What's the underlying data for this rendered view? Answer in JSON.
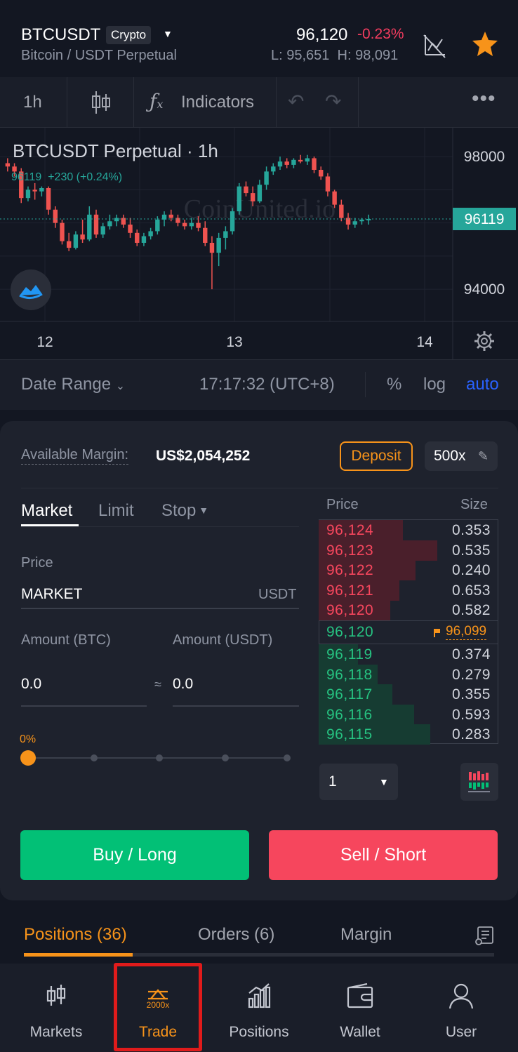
{
  "header": {
    "symbol": "BTCUSDT",
    "badge": "Crypto",
    "subtitle": "Bitcoin / USDT Perpetual",
    "price": "96,120",
    "change": "-0.23%",
    "hilo": "L: 95,651  H: 98,091",
    "icons": [
      "chart-off-icon",
      "star-icon"
    ]
  },
  "toolbar": {
    "interval": "1h",
    "indicators": "Indicators",
    "icons": [
      "candles-icon",
      "fx-icon",
      "undo-icon",
      "redo-icon",
      "more-icon"
    ]
  },
  "chart": {
    "title": "BTCUSDT Perpetual · 1h",
    "values": "96119  +230 (+0.24%)",
    "watermark": "CoinUnited.io",
    "y_labels": [
      "98000",
      "96119",
      "94000"
    ],
    "x_labels": [
      "12",
      "13",
      "14"
    ]
  },
  "chart_data": {
    "type": "candlestick",
    "ylim": [
      93200,
      98700
    ],
    "last_price": 96119,
    "ohlc": [
      [
        97800,
        97950,
        97550,
        97700
      ],
      [
        97700,
        97800,
        97400,
        97550
      ],
      [
        97550,
        97650,
        96600,
        96750
      ],
      [
        96750,
        97100,
        96650,
        97000
      ],
      [
        97000,
        97200,
        96700,
        96950
      ],
      [
        96950,
        97100,
        96800,
        97050
      ],
      [
        97050,
        97100,
        96250,
        96400
      ],
      [
        96400,
        96500,
        95850,
        96000
      ],
      [
        96000,
        96100,
        95350,
        95450
      ],
      [
        95450,
        95700,
        95150,
        95250
      ],
      [
        95250,
        95750,
        95200,
        95650
      ],
      [
        95650,
        96100,
        95400,
        95500
      ],
      [
        95500,
        96500,
        95450,
        96250
      ],
      [
        96250,
        96400,
        95550,
        95650
      ],
      [
        95650,
        96000,
        95550,
        95900
      ],
      [
        95900,
        96250,
        95800,
        96050
      ],
      [
        96050,
        96250,
        95900,
        96150
      ],
      [
        96150,
        96250,
        95850,
        95950
      ],
      [
        95950,
        96150,
        95550,
        95700
      ],
      [
        95700,
        95800,
        95300,
        95400
      ],
      [
        95400,
        95700,
        95300,
        95600
      ],
      [
        95600,
        95850,
        95500,
        95750
      ],
      [
        95750,
        96200,
        95650,
        96100
      ],
      [
        96100,
        96350,
        95900,
        96250
      ],
      [
        96250,
        96400,
        96050,
        96150
      ],
      [
        96150,
        96250,
        95900,
        96000
      ],
      [
        96000,
        96100,
        95800,
        95900
      ],
      [
        95900,
        96150,
        95800,
        96000
      ],
      [
        96000,
        96200,
        95750,
        95850
      ],
      [
        95850,
        96050,
        95300,
        95400
      ],
      [
        95400,
        95600,
        94000,
        95100
      ],
      [
        95100,
        95700,
        94700,
        95550
      ],
      [
        95550,
        95900,
        95200,
        95750
      ],
      [
        95750,
        96450,
        95650,
        96350
      ],
      [
        96350,
        97200,
        96250,
        97100
      ],
      [
        97100,
        97250,
        96800,
        96900
      ],
      [
        96900,
        97100,
        96500,
        96650
      ],
      [
        96650,
        97300,
        96600,
        97150
      ],
      [
        97150,
        97700,
        97000,
        97550
      ],
      [
        97550,
        97800,
        97450,
        97700
      ],
      [
        97700,
        98000,
        97600,
        97850
      ],
      [
        97850,
        97950,
        97650,
        97750
      ],
      [
        97750,
        97950,
        97650,
        97900
      ],
      [
        97900,
        98050,
        97800,
        97850
      ],
      [
        97850,
        98050,
        97750,
        97950
      ],
      [
        97950,
        98000,
        97500,
        97600
      ],
      [
        97600,
        97700,
        97300,
        97400
      ],
      [
        97400,
        97500,
        96800,
        96950
      ],
      [
        96950,
        97000,
        96450,
        96550
      ],
      [
        96550,
        96700,
        96050,
        96150
      ],
      [
        96150,
        96300,
        95800,
        95950
      ],
      [
        95950,
        96150,
        95850,
        96050
      ],
      [
        96050,
        96150,
        95950,
        96100
      ],
      [
        96100,
        96250,
        95950,
        96119
      ]
    ]
  },
  "datebar": {
    "range": "Date Range",
    "time": "17:17:32 (UTC+8)",
    "pct": "%",
    "log": "log",
    "auto": "auto"
  },
  "trade": {
    "available_label": "Available Margin:",
    "available_value": "US$2,054,252",
    "deposit": "Deposit",
    "leverage": "500x",
    "tabs": [
      "Market",
      "Limit",
      "Stop"
    ],
    "price_label": "Price",
    "price_value": "MARKET",
    "price_unit": "USDT",
    "amount_btc_label": "Amount (BTC)",
    "amount_usdt_label": "Amount (USDT)",
    "amount_btc": "0.0",
    "amount_usdt": "0.0",
    "approx": "≈",
    "slider_pct": "0%",
    "slider_value": 0,
    "buy": "Buy / Long",
    "sell": "Sell / Short"
  },
  "orderbook": {
    "price_header": "Price",
    "size_header": "Size",
    "asks": [
      {
        "price": "96,124",
        "size": "0.353",
        "depth": 0.47
      },
      {
        "price": "96,123",
        "size": "0.535",
        "depth": 0.66
      },
      {
        "price": "96,122",
        "size": "0.240",
        "depth": 0.54
      },
      {
        "price": "96,121",
        "size": "0.653",
        "depth": 0.45
      },
      {
        "price": "96,120",
        "size": "0.582",
        "depth": 0.4
      }
    ],
    "mid_price": "96,120",
    "mark_price": "96,099",
    "bids": [
      {
        "price": "96,119",
        "size": "0.374",
        "depth": 0.22
      },
      {
        "price": "96,118",
        "size": "0.279",
        "depth": 0.33
      },
      {
        "price": "96,117",
        "size": "0.355",
        "depth": 0.41
      },
      {
        "price": "96,116",
        "size": "0.593",
        "depth": 0.53
      },
      {
        "price": "96,115",
        "size": "0.283",
        "depth": 0.62
      }
    ],
    "depth_select": "1"
  },
  "positions_tabs": {
    "positions": "Positions (36)",
    "orders": "Orders (6)",
    "margin": "Margin"
  },
  "nav": {
    "markets": "Markets",
    "trade": "Trade",
    "trade_icon_text": "2000x",
    "positions": "Positions",
    "wallet": "Wallet",
    "user": "User"
  },
  "colors": {
    "up": "#26a69a",
    "down": "#ef5350",
    "accent": "#f7931a",
    "buy": "#02c076",
    "sell": "#f6465d",
    "link": "#2962ff"
  }
}
